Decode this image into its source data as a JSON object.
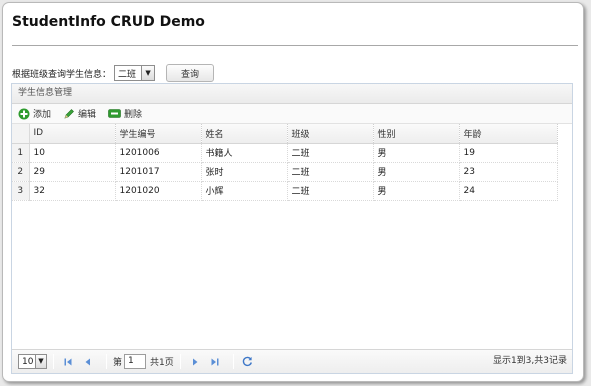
{
  "app": {
    "title": "StudentInfo CRUD Demo"
  },
  "filter": {
    "label": "根据班级查询学生信息：",
    "class_select": {
      "value": "二班"
    },
    "query_button": "查询"
  },
  "panel": {
    "title": "学生信息管理",
    "toolbar": {
      "add": "添加",
      "edit": "编辑",
      "delete": "删除"
    },
    "columns": [
      "ID",
      "学生编号",
      "姓名",
      "班级",
      "性别",
      "年龄"
    ],
    "rows": [
      {
        "num": "1",
        "id": "10",
        "student_no": "1201006",
        "name": "书籍人",
        "class": "二班",
        "gender": "男",
        "age": "19"
      },
      {
        "num": "2",
        "id": "29",
        "student_no": "1201017",
        "name": "张时",
        "class": "二班",
        "gender": "男",
        "age": "23"
      },
      {
        "num": "3",
        "id": "32",
        "student_no": "1201020",
        "name": "小辉",
        "class": "二班",
        "gender": "男",
        "age": "24"
      }
    ]
  },
  "pager": {
    "page_size": "10",
    "page_prefix": "第",
    "page_value": "1",
    "page_suffix": "共1页",
    "info": "显示1到3,共3记录"
  },
  "colors": {
    "accent_green": "#2e9b2e",
    "pager_icon_blue": "#5b8fd6"
  }
}
